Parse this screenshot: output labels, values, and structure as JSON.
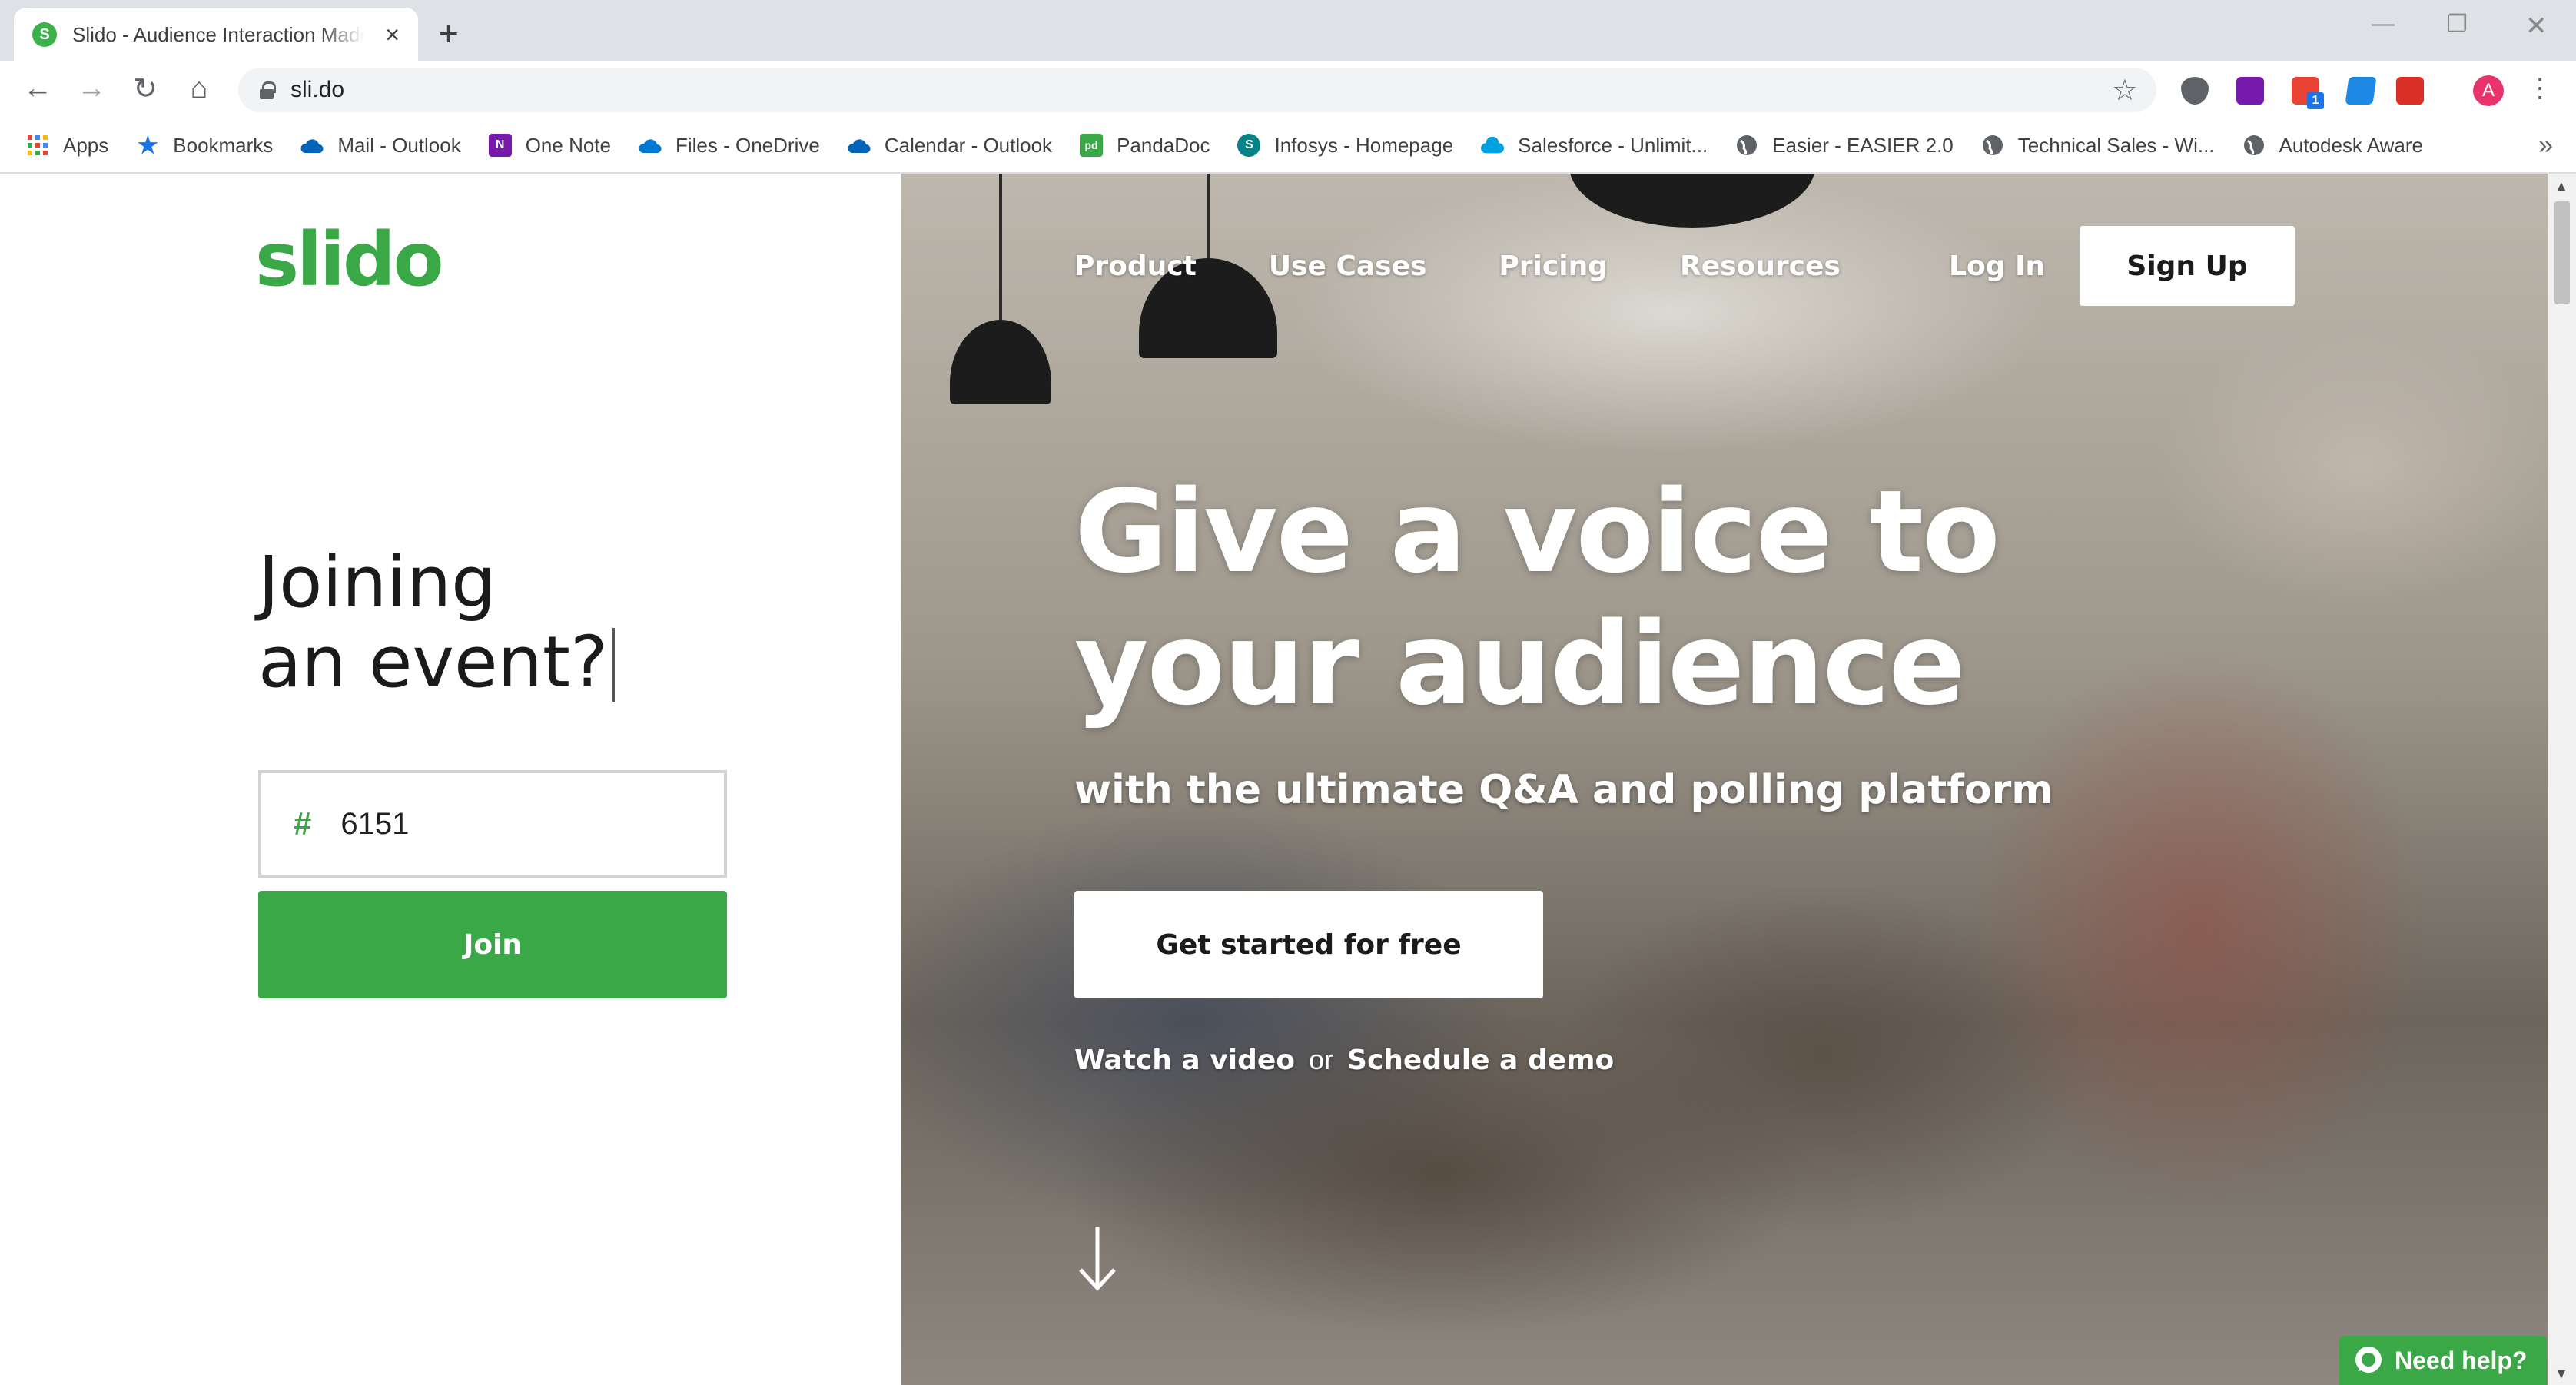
{
  "browser": {
    "tab_title": "Slido - Audience Interaction Made Easy",
    "tab_favicon_letter": "S",
    "tab_close": "×",
    "new_tab": "+",
    "url": "sli.do",
    "profile_initial": "A",
    "extension_badge": "1",
    "bookmarks": [
      {
        "label": "Apps",
        "icon": "apps-grid-icon",
        "color": "#ea4335"
      },
      {
        "label": "Bookmarks",
        "icon": "star-icon",
        "color": "#1a73e8"
      },
      {
        "label": "Mail - Outlook",
        "icon": "cloud-icon",
        "color": "#0364b8"
      },
      {
        "label": "One Note",
        "icon": "onenote-icon",
        "color": "#7719aa"
      },
      {
        "label": "Files - OneDrive",
        "icon": "onedrive-icon",
        "color": "#0078d4"
      },
      {
        "label": "Calendar - Outlook",
        "icon": "cloud-icon",
        "color": "#0364b8"
      },
      {
        "label": "PandaDoc",
        "icon": "pandadoc-icon",
        "color": "#3aa846"
      },
      {
        "label": "Infosys - Homepage",
        "icon": "sharepoint-icon",
        "color": "#038387"
      },
      {
        "label": "Salesforce - Unlimit...",
        "icon": "salesforce-icon",
        "color": "#00a1e0"
      },
      {
        "label": "Easier - EASIER 2.0",
        "icon": "globe-icon",
        "color": "#5f6368"
      },
      {
        "label": "Technical Sales - Wi...",
        "icon": "globe-icon",
        "color": "#5f6368"
      },
      {
        "label": "Autodesk Aware",
        "icon": "globe-icon",
        "color": "#5f6368"
      }
    ],
    "bookmarks_more": "»"
  },
  "left_panel": {
    "logo": "slido",
    "heading_line1": "Joining",
    "heading_line2": "an event?",
    "code_prefix": "#",
    "code_value": "6151",
    "join_label": "Join"
  },
  "hero": {
    "nav": [
      "Product",
      "Use Cases",
      "Pricing",
      "Resources"
    ],
    "login_label": "Log In",
    "signup_label": "Sign Up",
    "title_line1": "Give a voice to",
    "title_line2": "your audience",
    "subtitle": "with the ultimate Q&A and polling platform",
    "cta_label": "Get started for free",
    "watch_video": "Watch a video",
    "or": "or",
    "schedule_demo": "Schedule a demo"
  },
  "help_widget": {
    "label": "Need help?"
  },
  "colors": {
    "brand_green": "#3aa846",
    "chrome_tabbar": "#dee1e6"
  }
}
